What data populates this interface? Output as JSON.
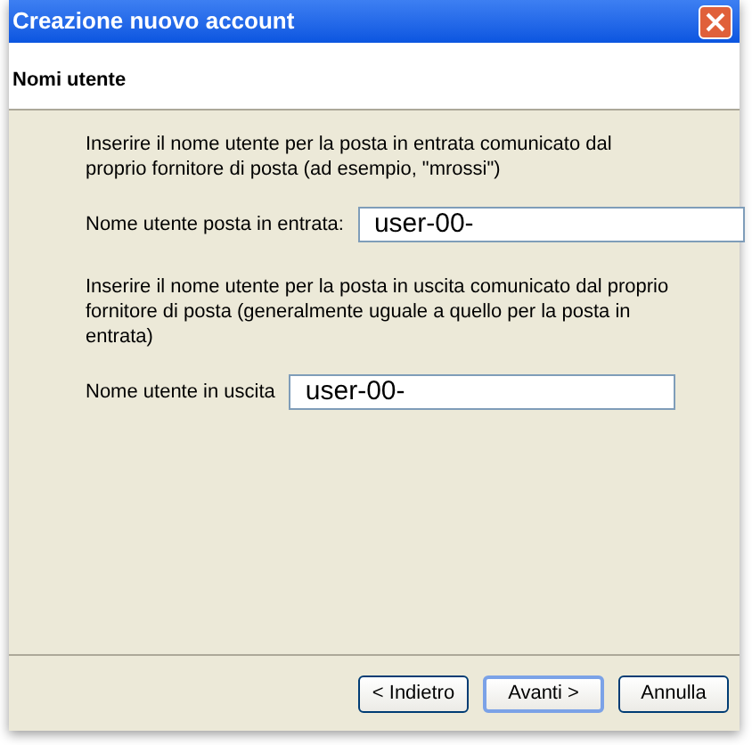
{
  "window": {
    "title": "Creazione nuovo account"
  },
  "header": {
    "title": "Nomi utente"
  },
  "sections": [
    {
      "description": "Inserire il nome utente per la posta in entrata comunicato dal proprio fornitore di posta (ad esempio, \"mrossi\")",
      "label": "Nome utente posta in entrata:",
      "value": "user-00-"
    },
    {
      "description": "Inserire il nome utente per la posta in uscita comunicato dal proprio fornitore di posta (generalmente uguale a quello per la posta in entrata)",
      "label": "Nome utente in uscita",
      "value": "user-00-"
    }
  ],
  "buttons": [
    {
      "label": "< Indietro",
      "selected": false
    },
    {
      "label": "Avanti >",
      "selected": true
    },
    {
      "label": "Annulla",
      "selected": false
    }
  ]
}
